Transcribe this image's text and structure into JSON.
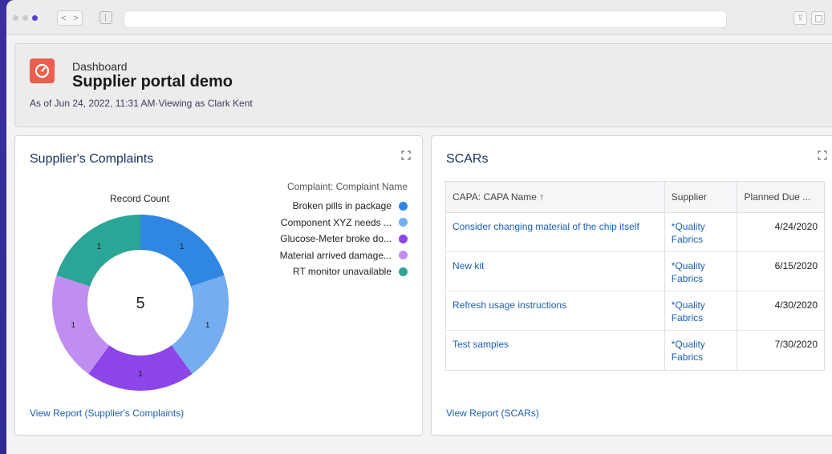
{
  "header": {
    "label": "Dashboard",
    "title": "Supplier portal demo",
    "meta": "As of Jun 24, 2022, 11:31 AM·Viewing as Clark Kent"
  },
  "complaints": {
    "title": "Supplier's Complaints",
    "metric_label": "Record Count",
    "total": "5",
    "legend_title": "Complaint: Complaint Name",
    "items": [
      {
        "label": "Broken pills in package",
        "value": "1",
        "color": "#2f86e3"
      },
      {
        "label": "Component XYZ needs ...",
        "value": "1",
        "color": "#74adf0"
      },
      {
        "label": "Glucose-Meter broke do...",
        "value": "1",
        "color": "#8b45e8"
      },
      {
        "label": "Material arrived damage...",
        "value": "1",
        "color": "#c08ef0"
      },
      {
        "label": "RT monitor unavailable",
        "value": "1",
        "color": "#2ba596"
      }
    ],
    "report_link": "View Report (Supplier's Complaints)"
  },
  "scars": {
    "title": "SCARs",
    "columns": [
      "CAPA: CAPA Name ↑",
      "Supplier",
      "Planned Due ..."
    ],
    "rows": [
      {
        "name": "Consider changing material of the chip itself",
        "supplier": "*Quality Fabrics",
        "due": "4/24/2020"
      },
      {
        "name": "New kit",
        "supplier": "*Quality Fabrics",
        "due": "6/15/2020"
      },
      {
        "name": "Refresh usage instructions",
        "supplier": "*Quality Fabrics",
        "due": "4/30/2020"
      },
      {
        "name": "Test samples",
        "supplier": "*Quality Fabrics",
        "due": "7/30/2020"
      }
    ],
    "report_link": "View Report (SCARs)"
  },
  "icons": {
    "app": "gauge-icon",
    "expand": "expand-icon"
  },
  "colors": {
    "link": "#1c5fb3",
    "app_icon": "#ec5e4f",
    "title": "#16325c"
  }
}
